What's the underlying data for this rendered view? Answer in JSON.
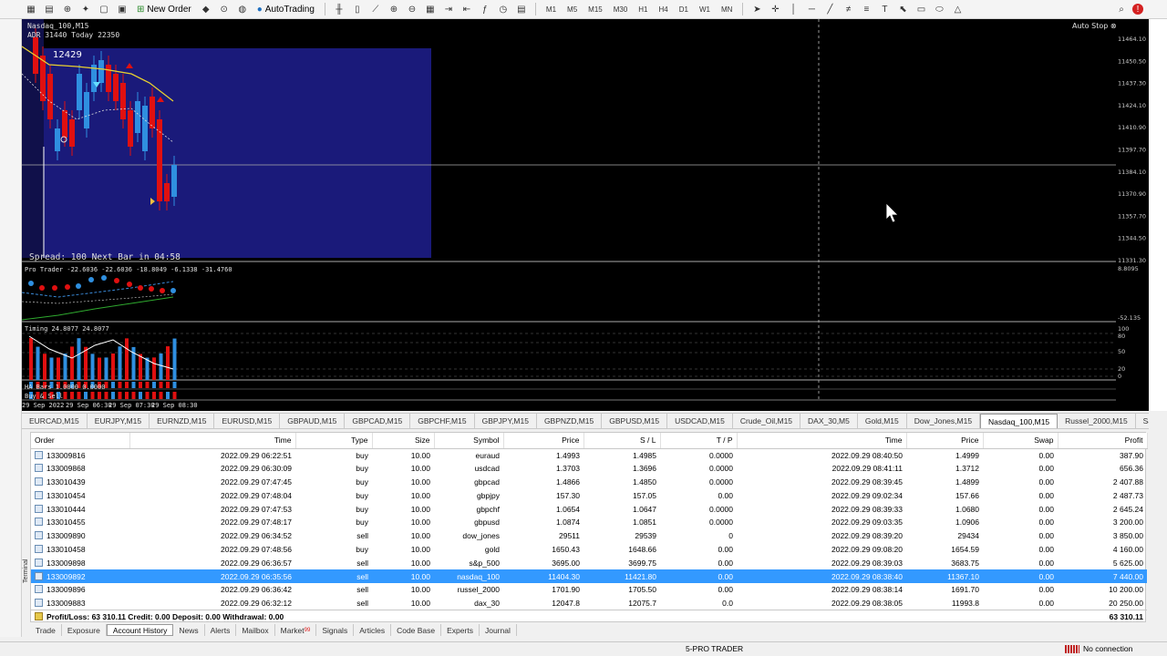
{
  "toolbar": {
    "new_order": "New Order",
    "auto_trading": "AutoTrading",
    "timeframes": [
      "M1",
      "M5",
      "M15",
      "M30",
      "H1",
      "H4",
      "D1",
      "W1",
      "MN"
    ]
  },
  "chart": {
    "symbol_label": "Nasdaq_100,M15",
    "adr_label": "ADR 31440  Today 22350",
    "box_value": "12429",
    "spread_label": "Spread: 100 Next Bar in 04:58",
    "auto_stop": "Auto Stop",
    "indicator1_label": "Pro Trader -22.6036 -22.6036 -18.8049 -6.1338 -31.4760",
    "indicator2_label": "Timing 24.8077 24.8077",
    "indicator3_label": "HA Bars 1.0000 0.0000",
    "indicator4_label": "Buy & Sell",
    "price_labels": [
      "11464.10",
      "11450.50",
      "11437.30",
      "11424.10",
      "11410.90",
      "11397.70",
      "11384.10",
      "11370.90",
      "11357.70",
      "11344.50",
      "11331.30"
    ],
    "current_price": "11388.20",
    "ind1_scale": [
      "8.8095",
      "-52.135"
    ],
    "ind2_scale": [
      "100",
      "80",
      "50",
      "20",
      "0"
    ],
    "time_labels": [
      "29 Sep 2022",
      "29 Sep 06:30",
      "29 Sep 07:30",
      "29 Sep 08:30"
    ]
  },
  "symbol_tabs": [
    "EURCAD,M15",
    "EURJPY,M15",
    "EURNZD,M15",
    "EURUSD,M15",
    "GBPAUD,M15",
    "GBPCAD,M15",
    "GBPCHF,M15",
    "GBPJPY,M15",
    "GBPNZD,M15",
    "GBPUSD,M15",
    "USDCAD,M15",
    "Crude_Oil,M15",
    "DAX_30,M5",
    "Gold,M15",
    "Dow_Jones,M15",
    "Nasdaq_100,M15",
    "Russel_2000,M15",
    "S&"
  ],
  "active_symbol_tab": "Nasdaq_100,M15",
  "history": {
    "columns": [
      "Order",
      "Time",
      "Type",
      "Size",
      "Symbol",
      "Price",
      "S / L",
      "T / P",
      "Time",
      "Price",
      "Swap",
      "Profit"
    ],
    "rows": [
      [
        "133009816",
        "2022.09.29 06:22:51",
        "buy",
        "10.00",
        "euraud",
        "1.4993",
        "1.4985",
        "0.0000",
        "2022.09.29 08:40:50",
        "1.4999",
        "0.00",
        "387.90"
      ],
      [
        "133009868",
        "2022.09.29 06:30:09",
        "buy",
        "10.00",
        "usdcad",
        "1.3703",
        "1.3696",
        "0.0000",
        "2022.09.29 08:41:11",
        "1.3712",
        "0.00",
        "656.36"
      ],
      [
        "133010439",
        "2022.09.29 07:47:45",
        "buy",
        "10.00",
        "gbpcad",
        "1.4866",
        "1.4850",
        "0.0000",
        "2022.09.29 08:39:45",
        "1.4899",
        "0.00",
        "2 407.88"
      ],
      [
        "133010454",
        "2022.09.29 07:48:04",
        "buy",
        "10.00",
        "gbpjpy",
        "157.30",
        "157.05",
        "0.00",
        "2022.09.29 09:02:34",
        "157.66",
        "0.00",
        "2 487.73"
      ],
      [
        "133010444",
        "2022.09.29 07:47:53",
        "buy",
        "10.00",
        "gbpchf",
        "1.0654",
        "1.0647",
        "0.0000",
        "2022.09.29 08:39:33",
        "1.0680",
        "0.00",
        "2 645.24"
      ],
      [
        "133010455",
        "2022.09.29 07:48:17",
        "buy",
        "10.00",
        "gbpusd",
        "1.0874",
        "1.0851",
        "0.0000",
        "2022.09.29 09:03:35",
        "1.0906",
        "0.00",
        "3 200.00"
      ],
      [
        "133009890",
        "2022.09.29 06:34:52",
        "sell",
        "10.00",
        "dow_jones",
        "29511",
        "29539",
        "0",
        "2022.09.29 08:39:20",
        "29434",
        "0.00",
        "3 850.00"
      ],
      [
        "133010458",
        "2022.09.29 07:48:56",
        "buy",
        "10.00",
        "gold",
        "1650.43",
        "1648.66",
        "0.00",
        "2022.09.29 09:08:20",
        "1654.59",
        "0.00",
        "4 160.00"
      ],
      [
        "133009898",
        "2022.09.29 06:36:57",
        "sell",
        "10.00",
        "s&p_500",
        "3695.00",
        "3699.75",
        "0.00",
        "2022.09.29 08:39:03",
        "3683.75",
        "0.00",
        "5 625.00"
      ],
      [
        "133009892",
        "2022.09.29 06:35:56",
        "sell",
        "10.00",
        "nasdaq_100",
        "11404.30",
        "11421.80",
        "0.00",
        "2022.09.29 08:38:40",
        "11367.10",
        "0.00",
        "7 440.00"
      ],
      [
        "133009896",
        "2022.09.29 06:36:42",
        "sell",
        "10.00",
        "russel_2000",
        "1701.90",
        "1705.50",
        "0.00",
        "2022.09.29 08:38:14",
        "1691.70",
        "0.00",
        "10 200.00"
      ],
      [
        "133009883",
        "2022.09.29 06:32:12",
        "sell",
        "10.00",
        "dax_30",
        "12047.8",
        "12075.7",
        "0.0",
        "2022.09.29 08:38:05",
        "11993.8",
        "0.00",
        "20 250.00"
      ]
    ],
    "selected_row": 9,
    "summary": "Profit/Loss: 63 310.11  Credit: 0.00  Deposit: 0.00  Withdrawal: 0.00",
    "summary_total": "63 310.11"
  },
  "bottom_tabs": [
    "Trade",
    "Exposure",
    "Account History",
    "News",
    "Alerts",
    "Mailbox",
    "Market",
    "Signals",
    "Articles",
    "Code Base",
    "Experts",
    "Journal"
  ],
  "market_badge": "99",
  "active_bottom_tab": "Account History",
  "terminal_label": "Terminal",
  "status": {
    "profile": "5-PRO TRADER",
    "connection": "No connection"
  },
  "colors": {
    "chart_bg": "#000000",
    "panel_blue": "#1a1a7a",
    "bull": "#2f8fe0",
    "bear": "#e01010",
    "ma_yellow": "#e8d030",
    "selection": "#3399ff"
  }
}
